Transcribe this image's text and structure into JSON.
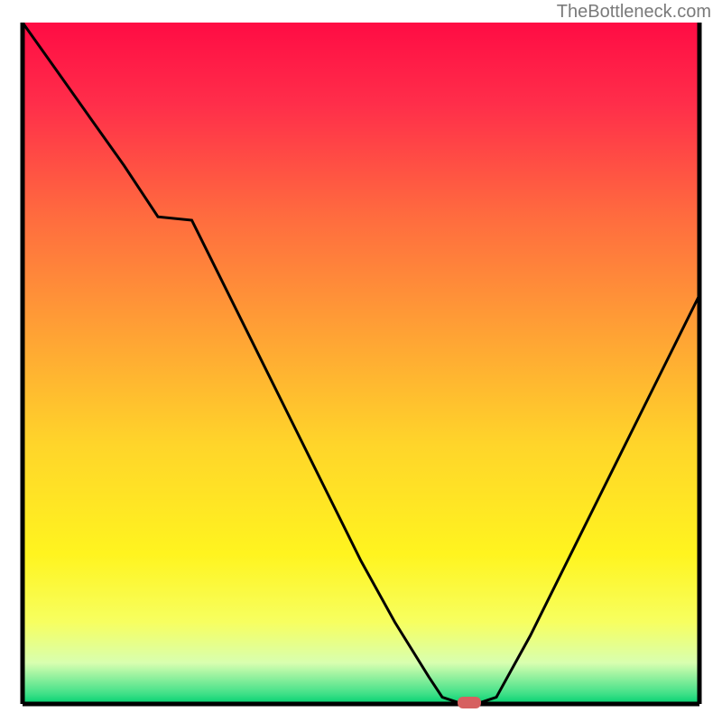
{
  "watermark": "TheBottleneck.com",
  "chart_data": {
    "type": "line",
    "title": "",
    "xlabel": "",
    "ylabel": "",
    "xlim": [
      0,
      100
    ],
    "ylim": [
      0,
      100
    ],
    "x": [
      0,
      5,
      10,
      15,
      20,
      25,
      30,
      35,
      40,
      45,
      50,
      55,
      60,
      62,
      65,
      67,
      70,
      75,
      80,
      85,
      90,
      95,
      100
    ],
    "values": [
      100,
      93,
      86,
      79,
      71.5,
      71,
      61,
      51,
      41,
      31,
      21,
      12,
      4,
      1,
      0,
      0,
      1,
      10,
      20,
      30,
      40,
      50,
      60
    ],
    "background_gradient": {
      "stops": [
        {
          "offset": 0.0,
          "color": "#ff0c44"
        },
        {
          "offset": 0.12,
          "color": "#ff2e4a"
        },
        {
          "offset": 0.28,
          "color": "#ff6a3f"
        },
        {
          "offset": 0.45,
          "color": "#ffa035"
        },
        {
          "offset": 0.62,
          "color": "#ffd52a"
        },
        {
          "offset": 0.78,
          "color": "#fff41f"
        },
        {
          "offset": 0.88,
          "color": "#f7ff60"
        },
        {
          "offset": 0.94,
          "color": "#d8ffb0"
        },
        {
          "offset": 0.985,
          "color": "#40e088"
        },
        {
          "offset": 1.0,
          "color": "#00d070"
        }
      ]
    },
    "marker": {
      "x": 66,
      "y": 0,
      "color": "#d66060"
    },
    "axes_color": "#000000",
    "line_color": "#000000"
  }
}
